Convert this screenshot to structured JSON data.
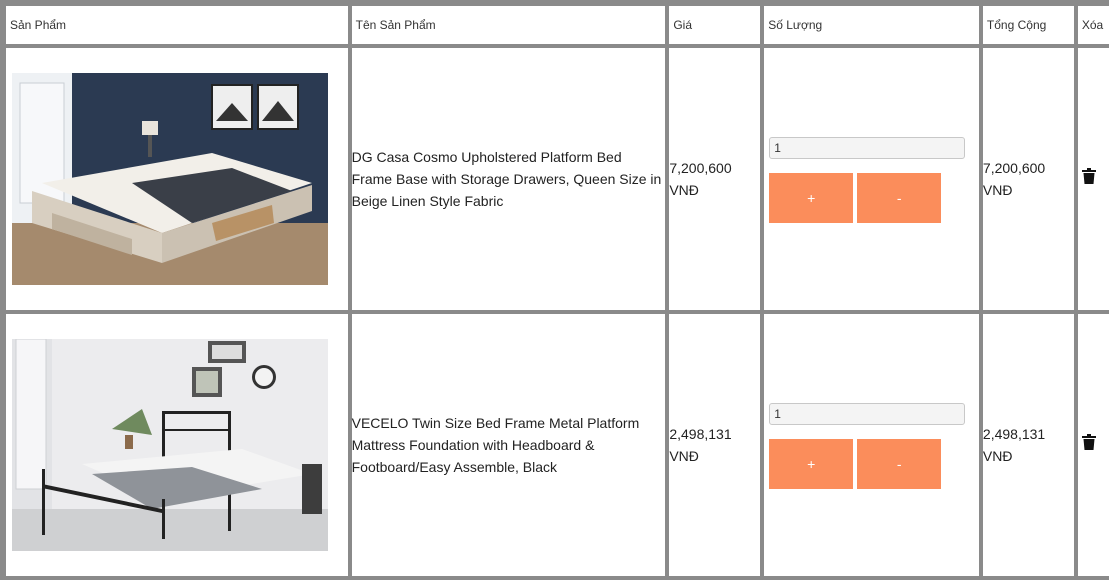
{
  "table": {
    "headers": [
      "Sản Phẩm",
      "Tên Sản Phẩm",
      "Giá",
      "Số Lượng",
      "Tổng Cộng",
      "Xóa"
    ],
    "rows": [
      {
        "image_desc": "upholstered-platform-bed-image",
        "name": "DG Casa Cosmo Upholstered Platform Bed Frame Base with Storage Drawers, Queen Size in Beige Linen Style Fabric",
        "price": "7,200,600 VNĐ",
        "quantity": "1",
        "total": "7,200,600 VNĐ"
      },
      {
        "image_desc": "metal-twin-bed-frame-image",
        "name": "VECELO Twin Size Bed Frame Metal Platform Mattress Foundation with Headboard & Footboard/Easy Assemble, Black",
        "price": "2,498,131 VNĐ",
        "quantity": "1",
        "total": "2,498,131 VNĐ"
      }
    ],
    "plus_label": "+",
    "minus_label": "-"
  },
  "colors": {
    "accent_button": "#fb8d5b",
    "border": "#8a8a8a"
  },
  "icons": {
    "delete": "trash-icon"
  }
}
